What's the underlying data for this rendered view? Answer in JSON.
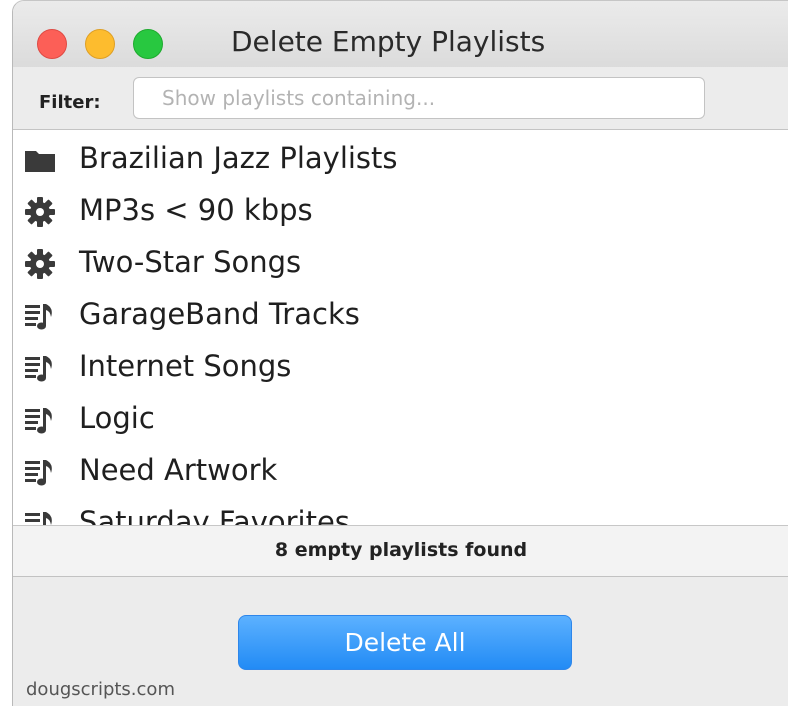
{
  "window": {
    "title": "Delete Empty Playlists"
  },
  "filter": {
    "label": "Filter:",
    "placeholder": "Show playlists containing...",
    "value": ""
  },
  "playlists": [
    {
      "label": "Brazilian Jazz Playlists",
      "icon": "folder-icon"
    },
    {
      "label": "MP3s < 90 kbps",
      "icon": "gear-icon"
    },
    {
      "label": "Two-Star Songs",
      "icon": "gear-icon"
    },
    {
      "label": "GarageBand Tracks",
      "icon": "playlist-icon"
    },
    {
      "label": "Internet Songs",
      "icon": "playlist-icon"
    },
    {
      "label": "Logic",
      "icon": "playlist-icon"
    },
    {
      "label": "Need Artwork",
      "icon": "playlist-icon"
    },
    {
      "label": "Saturday Favorites",
      "icon": "playlist-icon"
    }
  ],
  "status": {
    "text": "8 empty playlists found"
  },
  "actions": {
    "delete_all_label": "Delete All"
  },
  "footer": {
    "credit": "dougscripts.com"
  },
  "colors": {
    "close": "#fc5f57",
    "minimize": "#fdbc2e",
    "zoom": "#28c840",
    "button_blue": "#228bf5"
  }
}
